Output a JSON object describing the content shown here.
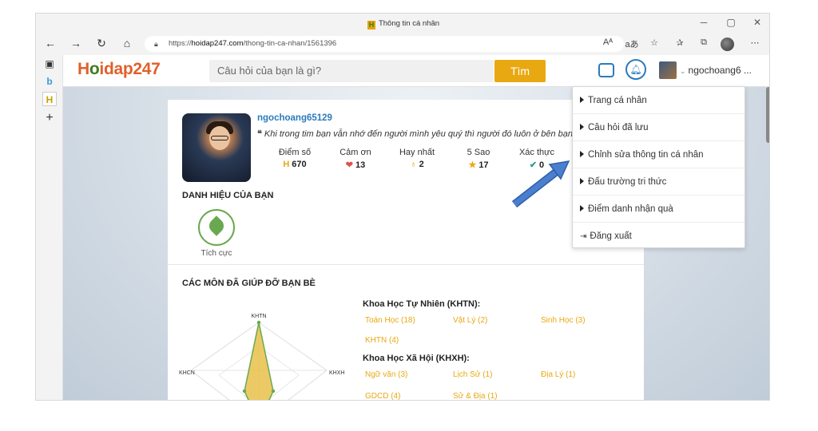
{
  "window": {
    "title": "Thông tin cá nhân",
    "minimize": "─",
    "maximize": "▢",
    "close": "✕"
  },
  "address_bar": {
    "url_prefix": "https://",
    "url_host": "hoidap247.com",
    "url_path": "/thong-tin-ca-nhan/1561396",
    "read_aloud_label": "Aᴬ",
    "translate_label": "aあ"
  },
  "site": {
    "logo_h": "H",
    "logo_o": "o",
    "logo_rest": "idap247",
    "search_placeholder": "Câu hỏi của bạn là gì?",
    "search_button": "Tìm",
    "username": "ngochoang6 ..."
  },
  "profile": {
    "username": "ngochoang65129",
    "quote": "Khi trong tim bạn vẫn nhớ đến người mình yêu quý thì người đó luôn ở bên bạn",
    "stats": [
      {
        "label": "Điểm số",
        "value": "670",
        "icon": "H",
        "color": "#e8a812"
      },
      {
        "label": "Cảm ơn",
        "value": "13",
        "icon": "❤",
        "color": "#d9534f"
      },
      {
        "label": "Hay nhất",
        "value": "2",
        "icon": "♁",
        "color": "#e8a812"
      },
      {
        "label": "5 Sao",
        "value": "17",
        "icon": "★",
        "color": "#e8a812"
      },
      {
        "label": "Xác thực",
        "value": "0",
        "icon": "✔",
        "color": "#2a9d8f"
      }
    ]
  },
  "badges": {
    "section_title": "DANH HIỆU CỦA BẠN",
    "badge_label": "Tích cực"
  },
  "subjects": {
    "section_title": "CÁC MÔN ĐÃ GIÚP ĐỠ BẠN BÈ",
    "radar_labels": {
      "top": "KHTN",
      "left": "KHCN",
      "right": "KHXH"
    },
    "groups": [
      {
        "title": "Khoa Học Tự Nhiên (KHTN):",
        "items": [
          "Toán Học (18)",
          "Vật Lý (2)",
          "Sinh Học (3)",
          "KHTN (4)"
        ]
      },
      {
        "title": "Khoa Học Xã Hội (KHXH):",
        "items": [
          "Ngữ văn (3)",
          "Lịch Sử (1)",
          "Địa Lý (1)",
          "GDCD (4)",
          "Sử & Địa (1)"
        ]
      }
    ]
  },
  "dropdown": {
    "items": [
      "Trang cá nhân",
      "Câu hỏi đã lưu",
      "Chỉnh sửa thông tin cá nhân",
      "Đấu trường tri thức",
      "Điểm danh nhận quà",
      "Đăng xuất"
    ]
  },
  "colors": {
    "accent": "#e8a812",
    "brand_blue": "#2b7bbd",
    "logo_orange": "#e0602a",
    "arrow_blue": "#3a6fc4"
  }
}
